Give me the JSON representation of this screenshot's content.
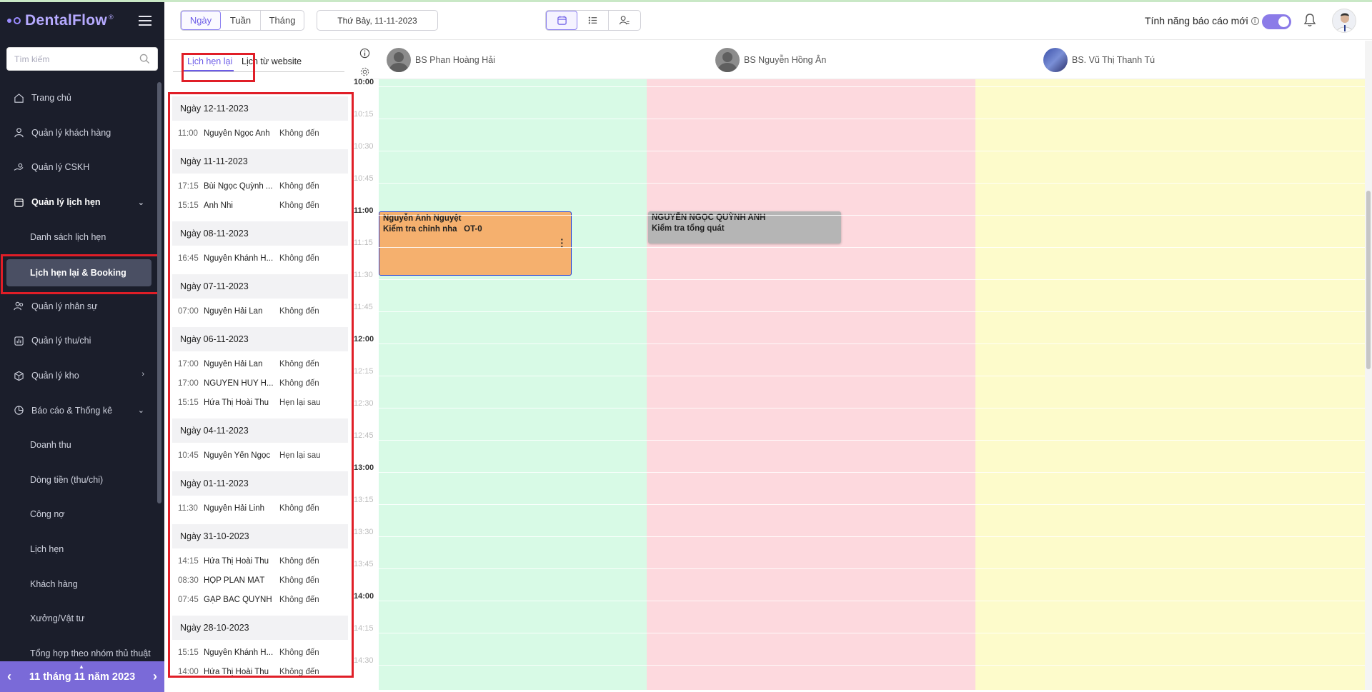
{
  "app": {
    "name": "DentalFlow"
  },
  "sidebar": {
    "search_placeholder": "Tìm kiếm",
    "items": [
      {
        "label": "Trang chủ"
      },
      {
        "label": "Quản lý khách hàng"
      },
      {
        "label": "Quản lý CSKH"
      },
      {
        "label": "Quản lý lịch hẹn"
      },
      {
        "label": "Danh sách lịch hẹn"
      },
      {
        "label": "Lịch hẹn lại & Booking"
      },
      {
        "label": "Quản lý nhân sự"
      },
      {
        "label": "Quản lý thu/chi"
      },
      {
        "label": "Quản lý kho"
      },
      {
        "label": "Báo cáo & Thống kê"
      },
      {
        "label": "Doanh thu"
      },
      {
        "label": "Dòng tiền (thu/chi)"
      },
      {
        "label": "Công nợ"
      },
      {
        "label": "Lịch hẹn"
      },
      {
        "label": "Khách hàng"
      },
      {
        "label": "Xưởng/Vật tư"
      },
      {
        "label": "Tổng hợp theo nhóm thủ thuật"
      }
    ],
    "date_nav_label": "11 tháng 11 năm 2023"
  },
  "toolbar": {
    "range_buttons": [
      "Ngày",
      "Tuần",
      "Tháng"
    ],
    "date": "Thứ Bảy, 11-11-2023",
    "feature_label": "Tính năng báo cáo mới",
    "feature_enabled": true
  },
  "panel": {
    "tabs": [
      "Lịch hẹn lại",
      "Lịch từ website"
    ],
    "groups": [
      {
        "date": "Ngày 12-11-2023",
        "items": [
          {
            "time": "11:00",
            "name": "Nguyễn Ngọc Anh",
            "status": "Không đến"
          }
        ]
      },
      {
        "date": "Ngày 11-11-2023",
        "items": [
          {
            "time": "17:15",
            "name": "Bùi Ngọc Quỳnh ...",
            "status": "Không đến"
          },
          {
            "time": "15:15",
            "name": "Ánh Nhi",
            "status": "Không đến"
          }
        ]
      },
      {
        "date": "Ngày 08-11-2023",
        "items": [
          {
            "time": "16:45",
            "name": "Nguyễn Khánh H...",
            "status": "Không đến"
          }
        ]
      },
      {
        "date": "Ngày 07-11-2023",
        "items": [
          {
            "time": "07:00",
            "name": "Nguyễn Hải Lan",
            "status": "Không đến"
          }
        ]
      },
      {
        "date": "Ngày 06-11-2023",
        "items": [
          {
            "time": "17:00",
            "name": "Nguyễn Hải Lan",
            "status": "Không đến"
          },
          {
            "time": "17:00",
            "name": "NGUYỄN HUY H...",
            "status": "Không đến"
          },
          {
            "time": "15:15",
            "name": "Hứa Thị Hoài Thu",
            "status": "Hẹn lại sau"
          }
        ]
      },
      {
        "date": "Ngày 04-11-2023",
        "items": [
          {
            "time": "10:45",
            "name": "Nguyễn Yến Ngọc",
            "status": "Hẹn lại sau"
          }
        ]
      },
      {
        "date": "Ngày 01-11-2023",
        "items": [
          {
            "time": "11:30",
            "name": "Nguyễn Hải Linh",
            "status": "Không đến"
          }
        ]
      },
      {
        "date": "Ngày 31-10-2023",
        "items": [
          {
            "time": "14:15",
            "name": "Hứa Thị Hoài Thu",
            "status": "Không đến"
          },
          {
            "time": "08:30",
            "name": "HỌP PLAN MẮT",
            "status": "Không đến"
          },
          {
            "time": "07:45",
            "name": "GẶP BÁC QUỲNH",
            "status": "Không đến"
          }
        ]
      },
      {
        "date": "Ngày 28-10-2023",
        "items": [
          {
            "time": "15:15",
            "name": "Nguyễn Khánh H...",
            "status": "Không đến"
          },
          {
            "time": "14:00",
            "name": "Hứa Thị Hoài Thu",
            "status": "Không đến"
          }
        ]
      }
    ]
  },
  "calendar": {
    "doctors": [
      {
        "name": "BS Phan Hoàng Hải",
        "color": "#d8fae6"
      },
      {
        "name": "BS Nguyễn Hồng Ân",
        "color": "#fdd9de"
      },
      {
        "name": "BS. Vũ Thị Thanh Tú",
        "color": "#fdfbcb"
      }
    ],
    "times": [
      "10:00",
      "10:15",
      "10:30",
      "10:45",
      "11:00",
      "11:15",
      "11:30",
      "11:45",
      "12:00",
      "12:15",
      "12:30",
      "12:45",
      "13:00",
      "13:15",
      "13:30",
      "13:45",
      "14:00",
      "14:15",
      "14:30"
    ],
    "appointments": [
      {
        "patient": "Nguyễn Anh Nguyệt",
        "service": "Kiểm tra chỉnh nha",
        "code": "OT-0",
        "color": "#f5b06e"
      },
      {
        "patient": "NGUYỄN NGỌC QUỲNH ANH",
        "service": "Kiểm tra tổng quát",
        "color": "#b5b5b5"
      }
    ]
  },
  "colors": {
    "accent": "#6c5ce7",
    "highlight": "#e01e27",
    "sidebar_bg": "#1b1e2b"
  }
}
